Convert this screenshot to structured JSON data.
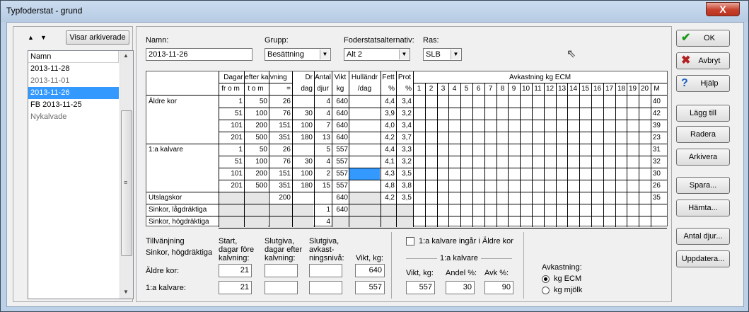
{
  "window": {
    "title": "Typfoderstat - grund",
    "close_glyph": "X"
  },
  "left": {
    "sort_up": "▲",
    "sort_down": "▼",
    "show_archived": "Visar arkiverade",
    "list_header": "Namn",
    "items": [
      "2013-11-28",
      "2013-11-01",
      "2013-11-26",
      "FB 2013-11-25",
      "Nykalvade"
    ],
    "selected_index": 2
  },
  "form": {
    "name_label": "Namn:",
    "name_value": "2013-11-26",
    "group_label": "Grupp:",
    "group_value": "Besättning",
    "alt_label": "Foderstatsalternativ:",
    "alt_value": "Alt 2",
    "breed_label": "Ras:",
    "breed_value": "SLB"
  },
  "table": {
    "hdr_dagar": "Dagar efter kalvning",
    "hdr_from": "fr o m",
    "hdr_tom": "t o m",
    "hdr_eq": "=",
    "hdr_dr": "Dr",
    "hdr_dag": "dag",
    "hdr_antal": "Antal",
    "hdr_djur": "djur",
    "hdr_vikt": "Vikt",
    "hdr_kg": "kg",
    "hdr_hull": "Hulländr",
    "hdr_perdag": "/dag",
    "hdr_fett": "Fett",
    "hdr_fettpct": "%",
    "hdr_prot": "Prot",
    "hdr_protpct": "%",
    "hdr_avk": "Avkastning kg ECM",
    "avk_cols": [
      "1",
      "2",
      "3",
      "4",
      "5",
      "6",
      "7",
      "8",
      "9",
      "10",
      "11",
      "12",
      "13",
      "14",
      "15",
      "16",
      "17",
      "18",
      "19",
      "20",
      "M"
    ],
    "groups": [
      "Äldre kor",
      "1:a kalvare",
      "Utslagskor",
      "Sinkor, lågdräktiga",
      "Sinkor, högdräktiga"
    ],
    "rows": [
      {
        "from": "1",
        "tom": "50",
        "eq": "26",
        "dr": "",
        "antal": "4",
        "vikt": "640",
        "fett": "4,4",
        "prot": "3,4",
        "m": "40"
      },
      {
        "from": "51",
        "tom": "100",
        "eq": "76",
        "dr": "30",
        "antal": "4",
        "vikt": "640",
        "fett": "3,9",
        "prot": "3,2",
        "m": "42"
      },
      {
        "from": "101",
        "tom": "200",
        "eq": "151",
        "dr": "100",
        "antal": "7",
        "vikt": "640",
        "fett": "4,0",
        "prot": "3,4",
        "m": "39"
      },
      {
        "from": "201",
        "tom": "500",
        "eq": "351",
        "dr": "180",
        "antal": "13",
        "vikt": "640",
        "fett": "4,2",
        "prot": "3,7",
        "m": "23"
      },
      {
        "from": "1",
        "tom": "50",
        "eq": "26",
        "dr": "",
        "antal": "5",
        "vikt": "557",
        "fett": "4,4",
        "prot": "3,3",
        "m": "31"
      },
      {
        "from": "51",
        "tom": "100",
        "eq": "76",
        "dr": "30",
        "antal": "4",
        "vikt": "557",
        "fett": "4,1",
        "prot": "3,2",
        "m": "32"
      },
      {
        "from": "101",
        "tom": "200",
        "eq": "151",
        "dr": "100",
        "antal": "2",
        "vikt": "557",
        "fett": "4,3",
        "prot": "3,5",
        "m": "30"
      },
      {
        "from": "201",
        "tom": "500",
        "eq": "351",
        "dr": "180",
        "antal": "15",
        "vikt": "557",
        "fett": "4,8",
        "prot": "3,8",
        "m": "26"
      },
      {
        "from": "",
        "tom": "",
        "eq": "200",
        "dr": "",
        "antal": "",
        "vikt": "640",
        "fett": "4,2",
        "prot": "3,5",
        "m": "35"
      },
      {
        "from": "",
        "tom": "",
        "eq": "",
        "dr": "",
        "antal": "1",
        "vikt": "640",
        "fett": "",
        "prot": "",
        "m": ""
      },
      {
        "from": "",
        "tom": "",
        "eq": "",
        "dr": "",
        "antal": "4",
        "vikt": "",
        "fett": "",
        "prot": "",
        "m": ""
      }
    ]
  },
  "bottom": {
    "tillv1": "Tillvänjning",
    "tillv2": "Sinkor, högdräktiga",
    "start_hdr": [
      "Start,",
      "dagar före",
      "kalvning:"
    ],
    "slut_hdr": [
      "Slutgiva,",
      "dagar efter",
      "kalvning:"
    ],
    "slutniva_hdr": [
      "Slutgiva,",
      "avkast-",
      "ningsnivå:"
    ],
    "vikt_hdr": "Vikt, kg:",
    "aldre_label": "Äldre kor:",
    "aldre_start": "21",
    "aldre_vikt": "640",
    "kalv_label": "1:a kalvare:",
    "kalv_start": "21",
    "kalv_vikt": "557",
    "chk_label": "1:a kalvare ingår i Äldre kor",
    "kalv_group": "1:a kalvare",
    "vikt_label": "Vikt, kg:",
    "andel_label": "Andel %:",
    "avk_label": "Avk %:",
    "vikt_val": "557",
    "andel_val": "30",
    "avk_val": "90",
    "avkastning_label": "Avkastning:",
    "opt_ecm": "kg ECM",
    "opt_mjolk": "kg mjölk"
  },
  "buttons": {
    "ok": "OK",
    "cancel": "Avbryt",
    "help": "Hjälp",
    "add": "Lägg till",
    "delete": "Radera",
    "archive": "Arkivera",
    "save": "Spara...",
    "fetch": "Hämta...",
    "count": "Antal djur...",
    "update": "Uppdatera..."
  },
  "colors": {
    "selection": "#3399ff",
    "ok_icon": "#1a9a1a",
    "cancel_icon": "#b22222",
    "help_icon": "#1f5fbf"
  }
}
